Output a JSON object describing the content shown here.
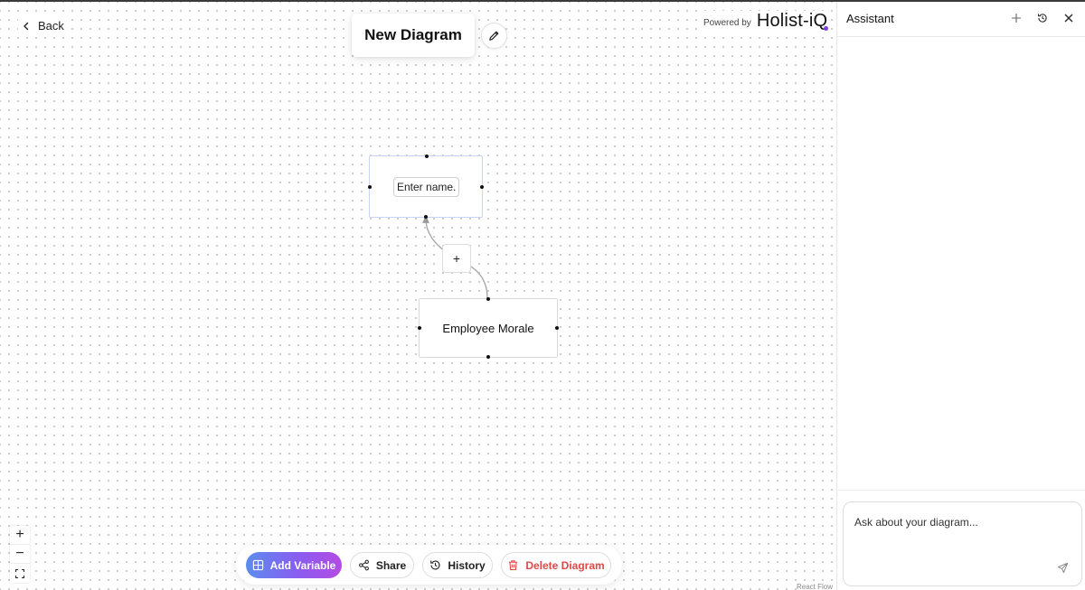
{
  "nav": {
    "back_label": "Back"
  },
  "diagram": {
    "title": "New Diagram"
  },
  "branding": {
    "powered_by": "Powered by",
    "logo_text": "Holist-iQ"
  },
  "nodes": {
    "top": {
      "placeholder": "Enter name.."
    },
    "bottom": {
      "label": "Employee Morale"
    }
  },
  "edge": {
    "add_label": "+"
  },
  "zoom_controls": {
    "zoom_in": "+",
    "zoom_out": "−"
  },
  "toolbar": {
    "add_variable": "Add Variable",
    "share": "Share",
    "history": "History",
    "delete_diagram": "Delete Diagram"
  },
  "attribution": "React Flow",
  "assistant": {
    "title": "Assistant",
    "input_placeholder": "Ask about your diagram..."
  },
  "colors": {
    "accent_gradient_start": "#5b8def",
    "accent_gradient_end": "#b44be3",
    "danger": "#e04848",
    "logo_dot": "#7b3fe4"
  },
  "icons": [
    "chevron-left-icon",
    "pencil-icon",
    "grid-icon",
    "share-icon",
    "history-icon",
    "trash-icon",
    "plus-icon",
    "close-icon",
    "send-icon",
    "fit-view-icon"
  ]
}
